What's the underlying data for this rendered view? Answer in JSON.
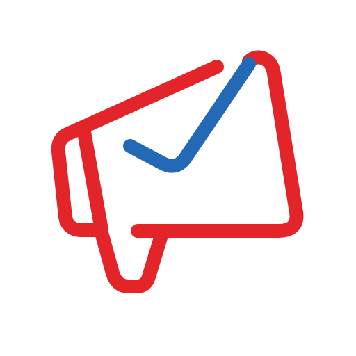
{
  "icon": {
    "name": "megaphone-envelope-check-icon",
    "colors": {
      "background": "#ffffff",
      "outline": "#e32428",
      "check": "#2469b5"
    }
  }
}
